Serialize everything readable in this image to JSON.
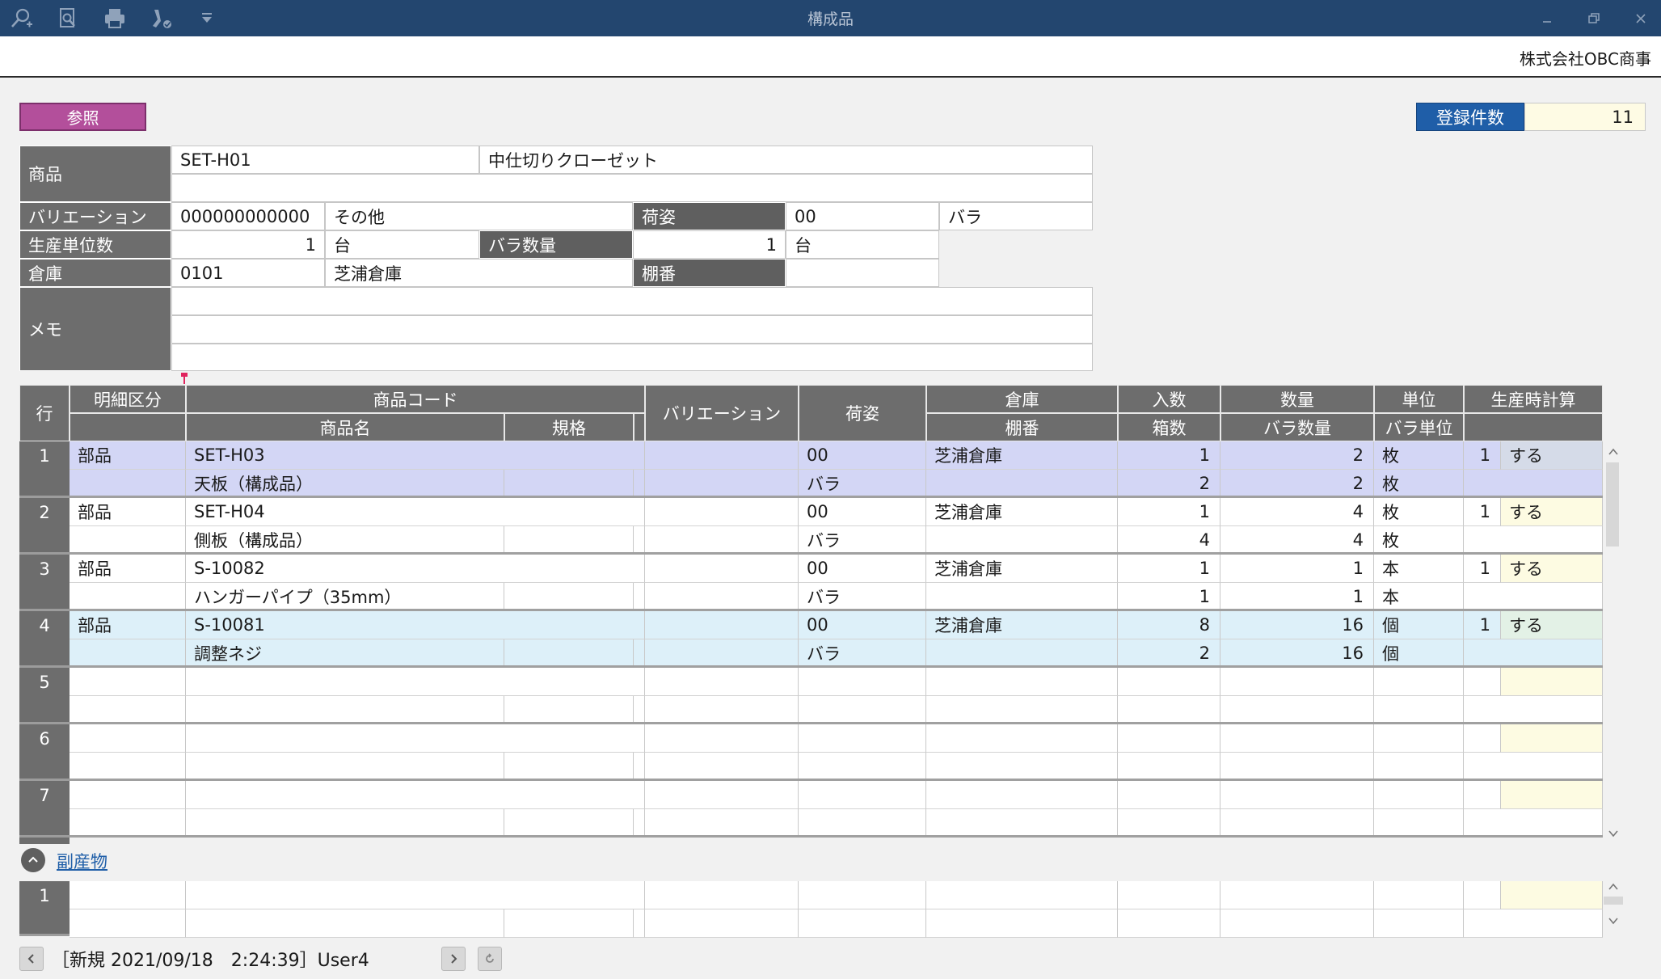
{
  "window": {
    "title": "構成品",
    "company": "株式会社OBC商事"
  },
  "toolbar": {
    "icons": [
      "search-plus-icon",
      "preview-icon",
      "print-icon",
      "check-tool-icon",
      "dropdown-arrow-icon"
    ]
  },
  "buttons": {
    "reference": "参照"
  },
  "record_count": {
    "label": "登録件数",
    "value": "11"
  },
  "form": {
    "product_label": "商品",
    "product_code": "SET-H01",
    "product_name": "中仕切りクローゼット",
    "variation_label": "バリエーション",
    "variation_code": "000000000000",
    "variation_name": "その他",
    "packing_label": "荷姿",
    "packing_code": "00",
    "packing_name": "バラ",
    "prod_unit_label": "生産単位数",
    "prod_unit_value": "1",
    "prod_unit_unit": "台",
    "bara_qty_label": "バラ数量",
    "bara_qty_value": "1",
    "bara_qty_unit": "台",
    "warehouse_label": "倉庫",
    "warehouse_code": "0101",
    "warehouse_name": "芝浦倉庫",
    "shelf_label": "棚番",
    "shelf_value": "",
    "memo_label": "メモ"
  },
  "grid": {
    "headers": {
      "row": "行",
      "detail_type": "明細区分",
      "product_code": "商品コード",
      "product_name": "商品名",
      "spec": "規格",
      "variation": "バリエーション",
      "packing": "荷姿",
      "warehouse": "倉庫",
      "shelf": "棚番",
      "per_box": "入数",
      "boxes": "箱数",
      "quantity": "数量",
      "bara_qty": "バラ数量",
      "unit": "単位",
      "bara_unit": "バラ単位",
      "prod_calc": "生産時計算"
    },
    "rows": [
      {
        "no": "1",
        "type": "部品",
        "code": "SET-H03",
        "name": "天板（構成品）",
        "packing_code": "00",
        "packing_name": "バラ",
        "warehouse": "芝浦倉庫",
        "per_box": "1",
        "boxes": "2",
        "qty": "2",
        "bara_qty": "2",
        "unit": "枚",
        "bara_unit": "枚",
        "calc_num": "1",
        "calc": "する"
      },
      {
        "no": "2",
        "type": "部品",
        "code": "SET-H04",
        "name": "側板（構成品）",
        "packing_code": "00",
        "packing_name": "バラ",
        "warehouse": "芝浦倉庫",
        "per_box": "1",
        "boxes": "4",
        "qty": "4",
        "bara_qty": "4",
        "unit": "枚",
        "bara_unit": "枚",
        "calc_num": "1",
        "calc": "する"
      },
      {
        "no": "3",
        "type": "部品",
        "code": "S-10082",
        "name": "ハンガーパイプ（35mm）",
        "packing_code": "00",
        "packing_name": "バラ",
        "warehouse": "芝浦倉庫",
        "per_box": "1",
        "boxes": "1",
        "qty": "1",
        "bara_qty": "1",
        "unit": "本",
        "bara_unit": "本",
        "calc_num": "1",
        "calc": "する"
      },
      {
        "no": "4",
        "type": "部品",
        "code": "S-10081",
        "name": "調整ネジ",
        "packing_code": "00",
        "packing_name": "バラ",
        "warehouse": "芝浦倉庫",
        "per_box": "8",
        "boxes": "2",
        "qty": "16",
        "bara_qty": "16",
        "unit": "個",
        "bara_unit": "個",
        "calc_num": "1",
        "calc": "する"
      },
      {
        "no": "5"
      },
      {
        "no": "6"
      },
      {
        "no": "7"
      }
    ]
  },
  "byproduct": {
    "label": "副産物",
    "rows": [
      {
        "no": "1"
      }
    ]
  },
  "footer": {
    "status": "［新規 2021/09/18　2:24:39］User4"
  }
}
